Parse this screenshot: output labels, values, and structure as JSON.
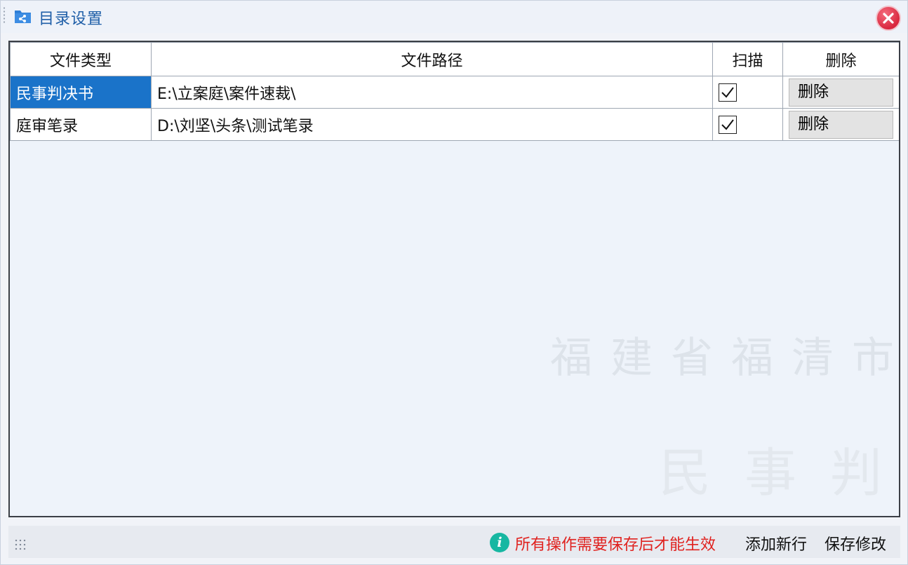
{
  "window": {
    "title": "目录设置",
    "title_icon": "folder-settings-icon",
    "close_icon": "close-icon",
    "accent": "#1f5fa8",
    "close_color": "#d9283f"
  },
  "table": {
    "columns": [
      "文件类型",
      "文件路径",
      "扫描",
      "删除"
    ],
    "rows": [
      {
        "file_type": "民事判决书",
        "file_path": "E:\\立案庭\\案件速裁\\",
        "scan": true,
        "delete_label": "删除",
        "selected": true
      },
      {
        "file_type": "庭审笔录",
        "file_path": "D:\\刘坚\\头条\\测试笔录",
        "scan": true,
        "delete_label": "删除",
        "selected": false
      }
    ],
    "selection_color": "#1a73c9"
  },
  "watermark": {
    "line1": "福建省福清市",
    "line2": "民事判"
  },
  "statusbar": {
    "info_icon": "info-icon",
    "info_glyph": "i",
    "message": "所有操作需要保存后才能生效",
    "message_color": "#e0221f",
    "add_row_label": "添加新行",
    "save_label": "保存修改"
  }
}
